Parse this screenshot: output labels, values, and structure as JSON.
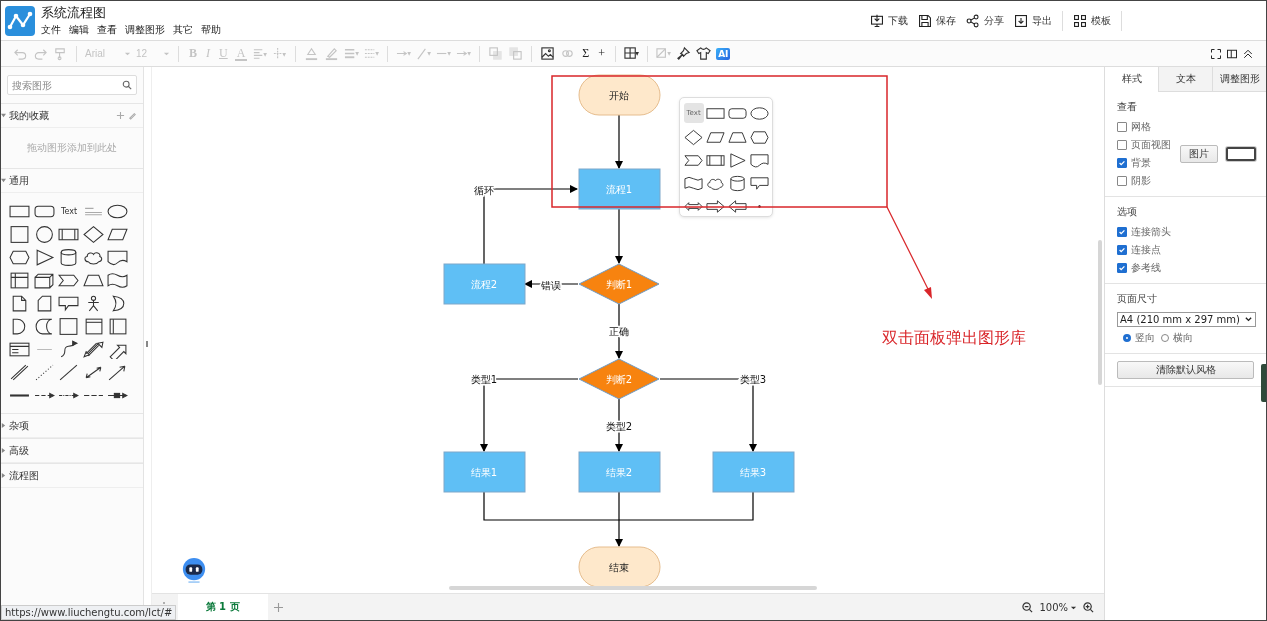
{
  "app": {
    "title": "系统流程图",
    "menus": [
      "文件",
      "编辑",
      "查看",
      "调整图形",
      "其它",
      "帮助"
    ]
  },
  "actions": [
    {
      "label": "下载"
    },
    {
      "label": "保存"
    },
    {
      "label": "分享"
    },
    {
      "label": "导出"
    },
    {
      "label": "模板"
    }
  ],
  "toolbar": {
    "items": [
      {
        "kind": "icon",
        "disabled": true
      },
      {
        "kind": "icon",
        "disabled": true
      },
      {
        "kind": "icon",
        "disabled": true
      },
      {
        "kind": "select",
        "value": "Arial",
        "disabled": true
      },
      {
        "kind": "select",
        "value": "12",
        "disabled": true
      },
      {
        "kind": "glyph",
        "label": "B",
        "disabled": true
      },
      {
        "kind": "glyph",
        "label": "I",
        "disabled": true
      },
      {
        "kind": "glyph",
        "label": "U",
        "disabled": true
      },
      {
        "kind": "glyph",
        "label": "A",
        "disabled": true
      },
      {
        "kind": "icon",
        "disabled": true
      },
      {
        "kind": "icon",
        "disabled": true
      },
      {
        "kind": "icon",
        "disabled": true
      },
      {
        "kind": "icon",
        "disabled": true
      },
      {
        "kind": "icon",
        "disabled": true
      },
      {
        "kind": "icon",
        "disabled": true
      },
      {
        "kind": "icon",
        "disabled": true
      },
      {
        "kind": "icon",
        "disabled": true
      },
      {
        "kind": "icon",
        "disabled": true
      },
      {
        "kind": "icon",
        "disabled": true
      },
      {
        "kind": "icon",
        "disabled": true
      },
      {
        "kind": "icon",
        "disabled": true
      },
      {
        "kind": "icon",
        "disabled": false
      },
      {
        "kind": "icon",
        "disabled": true
      },
      {
        "kind": "glyph",
        "label": "Σ",
        "disabled": false
      },
      {
        "kind": "glyph",
        "label": "+",
        "disabled": false
      },
      {
        "kind": "icon",
        "disabled": false
      },
      {
        "kind": "icon",
        "disabled": true
      },
      {
        "kind": "icon",
        "disabled": false
      },
      {
        "kind": "icon",
        "disabled": false
      },
      {
        "kind": "ai",
        "label": "AI",
        "disabled": false
      }
    ]
  },
  "sidebar": {
    "search": {
      "placeholder": "搜索图形"
    },
    "sections": [
      {
        "kind": "favorites",
        "label": "我的收藏",
        "expanded": true,
        "hint": "拖动图形添加到此处"
      },
      {
        "kind": "shapes",
        "label": "通用",
        "expanded": true,
        "text_tile": "Text"
      },
      {
        "kind": "plain",
        "label": "杂项",
        "expanded": false
      },
      {
        "kind": "plain",
        "label": "高级",
        "expanded": false
      },
      {
        "kind": "plain",
        "label": "流程图",
        "expanded": false
      }
    ]
  },
  "canvas": {
    "nodes": [
      {
        "kind": "terminal",
        "label": "开始"
      },
      {
        "kind": "process",
        "label": "流程1"
      },
      {
        "kind": "process",
        "label": "流程2"
      },
      {
        "kind": "decision",
        "label": "判断1"
      },
      {
        "kind": "decision",
        "label": "判断2"
      },
      {
        "kind": "process",
        "label": "结果1"
      },
      {
        "kind": "process",
        "label": "结果2"
      },
      {
        "kind": "process",
        "label": "结果3"
      },
      {
        "kind": "terminal",
        "label": "结束"
      }
    ],
    "edge_labels": [
      "循环",
      "错误",
      "正确",
      "类型1",
      "类型2",
      "类型3"
    ],
    "popup": {
      "text_tile": "Text"
    },
    "annotation": "双击面板弹出图形库"
  },
  "page_bar": {
    "pages": [
      {
        "label": "第 1 页",
        "selected": true
      }
    ],
    "zoom": "100%"
  },
  "format_panel": {
    "tabs": [
      {
        "label": "样式",
        "selected": true
      },
      {
        "label": "文本",
        "selected": false
      },
      {
        "label": "调整图形",
        "selected": false
      }
    ],
    "view": {
      "title": "查看",
      "options": [
        {
          "label": "网格",
          "checked": false
        },
        {
          "label": "页面视图",
          "checked": false
        },
        {
          "label": "背景",
          "checked": true
        },
        {
          "label": "阴影",
          "checked": false
        }
      ],
      "image_button": "图片"
    },
    "options": {
      "title": "选项",
      "items": [
        {
          "label": "连接箭头",
          "checked": true
        },
        {
          "label": "连接点",
          "checked": true
        },
        {
          "label": "参考线",
          "checked": true
        }
      ]
    },
    "page_size": {
      "title": "页面尺寸",
      "value": "A4 (210 mm x 297 mm)",
      "orientations": [
        {
          "label": "竖向",
          "selected": true
        },
        {
          "label": "横向",
          "selected": false
        }
      ]
    },
    "reset_button": "清除默认风格"
  },
  "status_url": "https://www.liuchengtu.com/lct/#"
}
